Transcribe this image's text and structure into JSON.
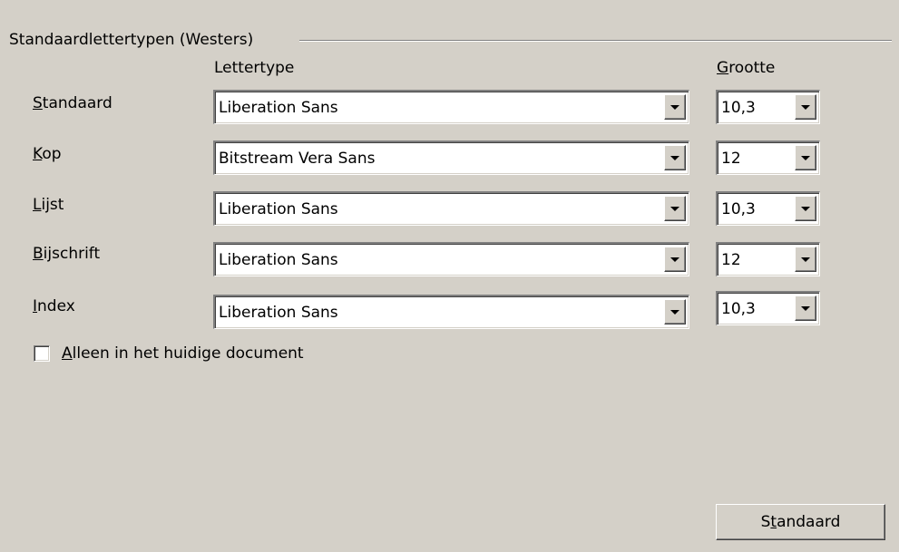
{
  "group": {
    "title": "Standaardlettertypen (Westers)"
  },
  "headers": {
    "font": "Lettertype",
    "size_underline": "G",
    "size_rest": "rootte"
  },
  "rows": [
    {
      "label_underline": "S",
      "label_rest": "tandaard",
      "font": "Liberation Sans",
      "size": "10,3"
    },
    {
      "label_underline": "K",
      "label_rest": "op",
      "font": "Bitstream Vera Sans",
      "size": "12"
    },
    {
      "label_underline": "L",
      "label_rest": "ijst",
      "font": "Liberation Sans",
      "size": "10,3"
    },
    {
      "label_underline": "B",
      "label_rest": "ijschrift",
      "font": "Liberation Sans",
      "size": "12"
    },
    {
      "label_underline": "I",
      "label_rest": "ndex",
      "font": "Liberation Sans",
      "size": "10,3"
    }
  ],
  "checkbox": {
    "label_underline": "A",
    "label_rest": "lleen in het huidige document",
    "checked": false
  },
  "default_button": {
    "label_before": "S",
    "label_underline": "t",
    "label_after": "andaard"
  },
  "icons": {
    "dropdown": "chevron-down-icon"
  },
  "colors": {
    "dialog_background": "#d4d0c8",
    "field_background": "#ffffff"
  }
}
